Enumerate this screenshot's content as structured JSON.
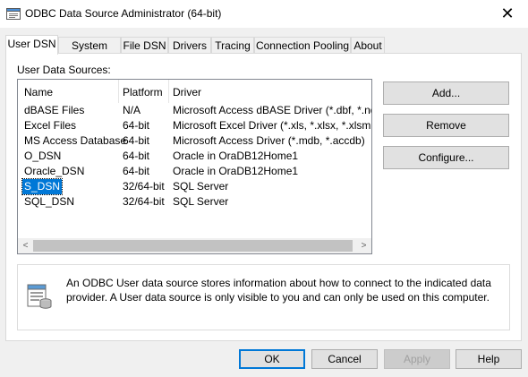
{
  "window": {
    "title": "ODBC Data Source Administrator (64-bit)",
    "close_glyph": "✕"
  },
  "tabs": [
    {
      "label": "User DSN",
      "active": true
    },
    {
      "label": "System DSN"
    },
    {
      "label": "File DSN"
    },
    {
      "label": "Drivers"
    },
    {
      "label": "Tracing"
    },
    {
      "label": "Connection Pooling"
    },
    {
      "label": "About"
    }
  ],
  "user_dsn": {
    "section_label": "User Data Sources:",
    "columns": [
      "Name",
      "Platform",
      "Driver"
    ],
    "rows": [
      {
        "name": "dBASE Files",
        "platform": "N/A",
        "driver": "Microsoft Access dBASE Driver (*.dbf, *.ndx, *.n"
      },
      {
        "name": "Excel Files",
        "platform": "64-bit",
        "driver": "Microsoft Excel Driver (*.xls, *.xlsx, *.xlsm, *.xlsb"
      },
      {
        "name": "MS Access Database",
        "platform": "64-bit",
        "driver": "Microsoft Access Driver (*.mdb, *.accdb)"
      },
      {
        "name": "O_DSN",
        "platform": "64-bit",
        "driver": "Oracle in OraDB12Home1"
      },
      {
        "name": "Oracle_DSN",
        "platform": "64-bit",
        "driver": "Oracle in OraDB12Home1"
      },
      {
        "name": "S_DSN",
        "platform": "32/64-bit",
        "driver": "SQL Server",
        "selected": true
      },
      {
        "name": "SQL_DSN",
        "platform": "32/64-bit",
        "driver": "SQL Server"
      }
    ],
    "scroll_left_glyph": "<",
    "scroll_right_glyph": ">",
    "buttons": {
      "add": "Add...",
      "remove": "Remove",
      "configure": "Configure..."
    },
    "info_text": "An ODBC User data source stores information about how to connect to the indicated data provider.   A User data source is only visible to you and can only be used on this computer."
  },
  "footer": {
    "ok": "OK",
    "cancel": "Cancel",
    "apply": "Apply",
    "help": "Help"
  },
  "colors": {
    "selection": "#0078d7",
    "default_button_border": "#0078d7"
  },
  "icons": [
    "app-icon",
    "close-icon",
    "database-info-icon"
  ]
}
